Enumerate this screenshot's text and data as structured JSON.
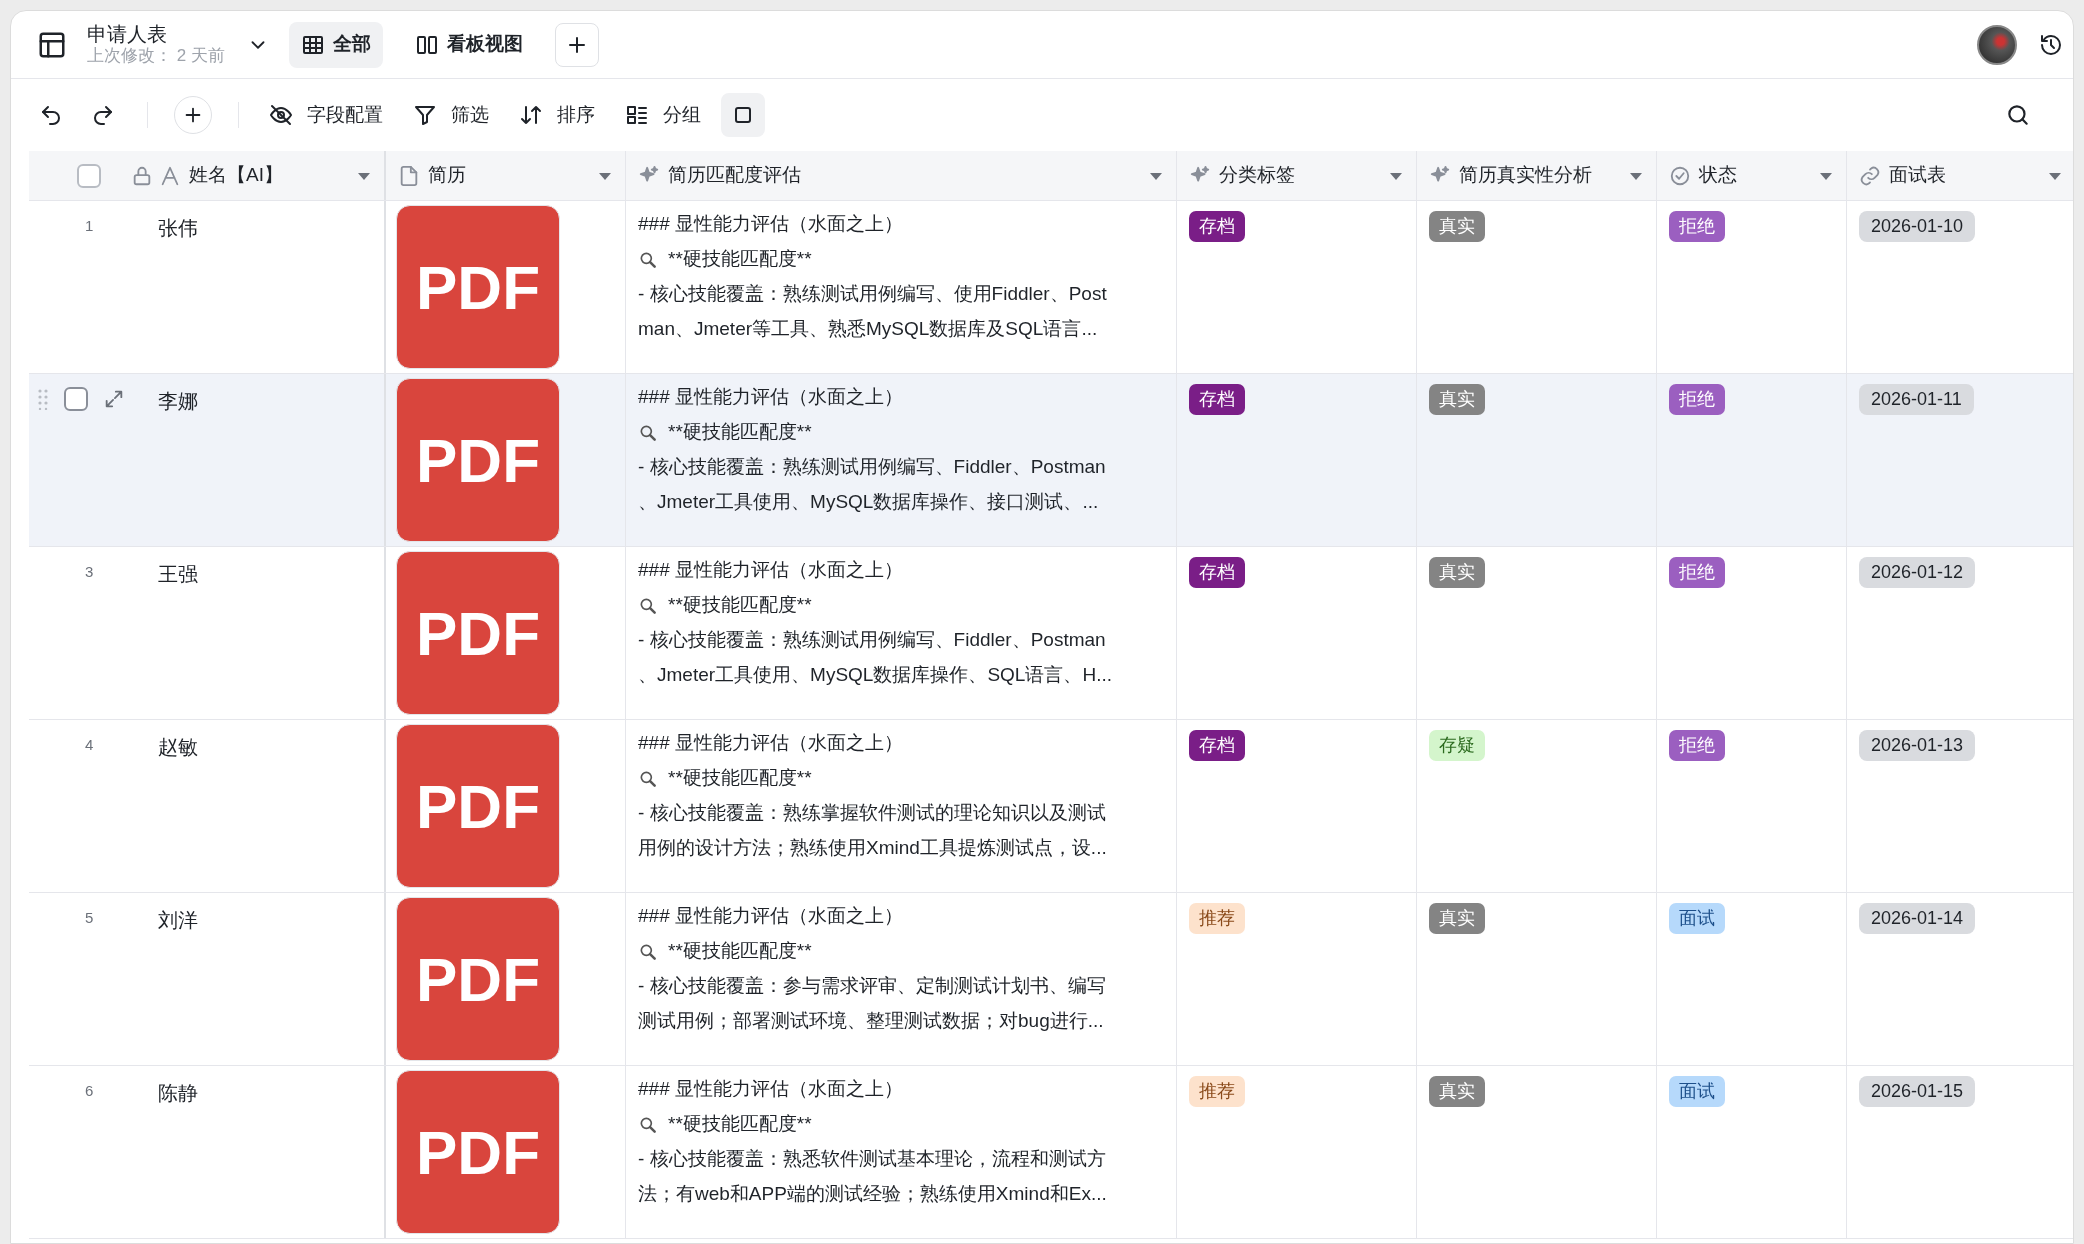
{
  "header": {
    "title": "申请人表",
    "subtitle": "上次修改： 2 天前",
    "views": [
      {
        "label": "全部",
        "kind": "grid",
        "selected": true
      },
      {
        "label": "看板视图",
        "kind": "kanban",
        "selected": false
      }
    ]
  },
  "toolbar": {
    "items": [
      {
        "label": "字段配置",
        "kind": "fields"
      },
      {
        "label": "筛选",
        "kind": "filter"
      },
      {
        "label": "排序",
        "kind": "sort"
      },
      {
        "label": "分组",
        "kind": "group"
      }
    ]
  },
  "table": {
    "all_selected": false,
    "columns": [
      {
        "label": "姓名【AI】",
        "kind": "name"
      },
      {
        "label": "简历",
        "kind": "file"
      },
      {
        "label": "简历匹配度评估",
        "kind": "ai"
      },
      {
        "label": "分类标签",
        "kind": "ai"
      },
      {
        "label": "简历真实性分析",
        "kind": "ai"
      },
      {
        "label": "状态",
        "kind": "status"
      },
      {
        "label": "面试表",
        "kind": "link"
      }
    ],
    "rows": [
      {
        "number": "1",
        "hovered": false,
        "name": "张伟",
        "resume": "PDF",
        "match_lines": [
          "### 显性能力评估（水面之上）",
          "**硬技能匹配度**",
          "- 核心技能覆盖：熟练测试用例编写、使用Fiddler、Post",
          "man、Jmeter等工具、熟悉MySQL数据库及SQL语言..."
        ],
        "category": {
          "label": "存档",
          "color": "#7a1e87"
        },
        "authenticity": {
          "label": "真实",
          "color": "#848484"
        },
        "status": {
          "label": "拒绝",
          "color": "#9b5fc0"
        },
        "interview": "2026-01-10"
      },
      {
        "hovered": true,
        "checked": false,
        "name": "李娜",
        "resume": "PDF",
        "match_lines": [
          "### 显性能力评估（水面之上）",
          "**硬技能匹配度**",
          "- 核心技能覆盖：熟练测试用例编写、Fiddler、Postman",
          "、Jmeter工具使用、MySQL数据库操作、接口测试、..."
        ],
        "category": {
          "label": "存档",
          "color": "#7a1e87"
        },
        "authenticity": {
          "label": "真实",
          "color": "#848484"
        },
        "status": {
          "label": "拒绝",
          "color": "#9b5fc0"
        },
        "interview": "2026-01-11"
      },
      {
        "number": "3",
        "hovered": false,
        "name": "王强",
        "resume": "PDF",
        "match_lines": [
          "### 显性能力评估（水面之上）",
          "**硬技能匹配度**",
          "- 核心技能覆盖：熟练测试用例编写、Fiddler、Postman",
          "、Jmeter工具使用、MySQL数据库操作、SQL语言、H..."
        ],
        "category": {
          "label": "存档",
          "color": "#7a1e87"
        },
        "authenticity": {
          "label": "真实",
          "color": "#848484"
        },
        "status": {
          "label": "拒绝",
          "color": "#9b5fc0"
        },
        "interview": "2026-01-12"
      },
      {
        "number": "4",
        "hovered": false,
        "name": "赵敏",
        "resume": "PDF",
        "match_lines": [
          "### 显性能力评估（水面之上）",
          "**硬技能匹配度**",
          "- 核心技能覆盖：熟练掌握软件测试的理论知识以及测试",
          "用例的设计方法；熟练使用Xmind工具提炼测试点，设..."
        ],
        "category": {
          "label": "存档",
          "color": "#7a1e87"
        },
        "authenticity": {
          "label": "存疑",
          "color": "#d4f5cc"
        },
        "status": {
          "label": "拒绝",
          "color": "#9b5fc0"
        },
        "interview": "2026-01-13"
      },
      {
        "number": "5",
        "hovered": false,
        "name": "刘洋",
        "resume": "PDF",
        "match_lines": [
          "### 显性能力评估（水面之上）",
          "**硬技能匹配度**",
          "- 核心技能覆盖：参与需求评审、定制测试计划书、编写",
          "测试用例；部署测试环境、整理测试数据；对bug进行..."
        ],
        "category": {
          "label": "推荐",
          "color": "#fde2cc"
        },
        "authenticity": {
          "label": "真实",
          "color": "#848484"
        },
        "status": {
          "label": "面试",
          "color": "#b6d9fb"
        },
        "interview": "2026-01-14"
      },
      {
        "number": "6",
        "hovered": false,
        "name": "陈静",
        "resume": "PDF",
        "match_lines": [
          "### 显性能力评估（水面之上）",
          "**硬技能匹配度**",
          "- 核心技能覆盖：熟悉软件测试基本理论，流程和测试方",
          "法；有web和APP端的测试经验；熟练使用Xmind和Ex..."
        ],
        "category": {
          "label": "推荐",
          "color": "#fde2cc"
        },
        "authenticity": {
          "label": "真实",
          "color": "#848484"
        },
        "status": {
          "label": "面试",
          "color": "#b6d9fb"
        },
        "interview": "2026-01-15"
      }
    ]
  }
}
